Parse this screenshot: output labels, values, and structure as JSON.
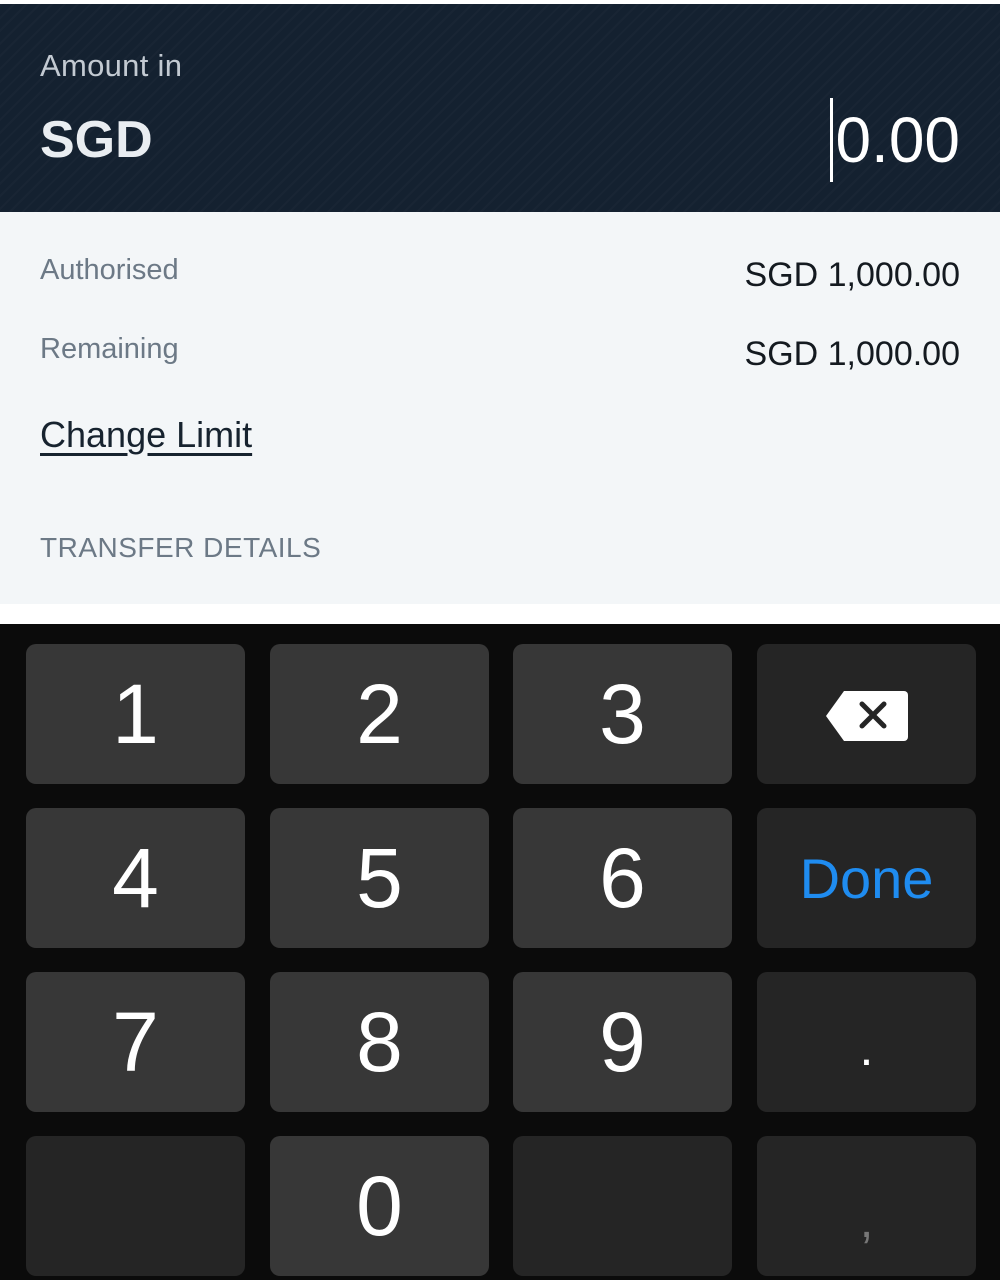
{
  "header": {
    "caption": "Amount in",
    "currency": "SGD",
    "amount_value": "0.00"
  },
  "limits": {
    "authorised_label": "Authorised",
    "authorised_value": "SGD 1,000.00",
    "remaining_label": "Remaining",
    "remaining_value": "SGD 1,000.00",
    "change_limit_label": "Change Limit"
  },
  "section": {
    "transfer_details_heading": "TRANSFER DETAILS"
  },
  "keypad": {
    "keys": [
      "1",
      "2",
      "3",
      "4",
      "5",
      "6",
      "7",
      "8",
      "9",
      "0"
    ],
    "done_label": "Done",
    "decimal_label": ".",
    "comma_label": ",",
    "backspace_icon": "backspace-icon",
    "done_color": "#1f8cf0"
  }
}
